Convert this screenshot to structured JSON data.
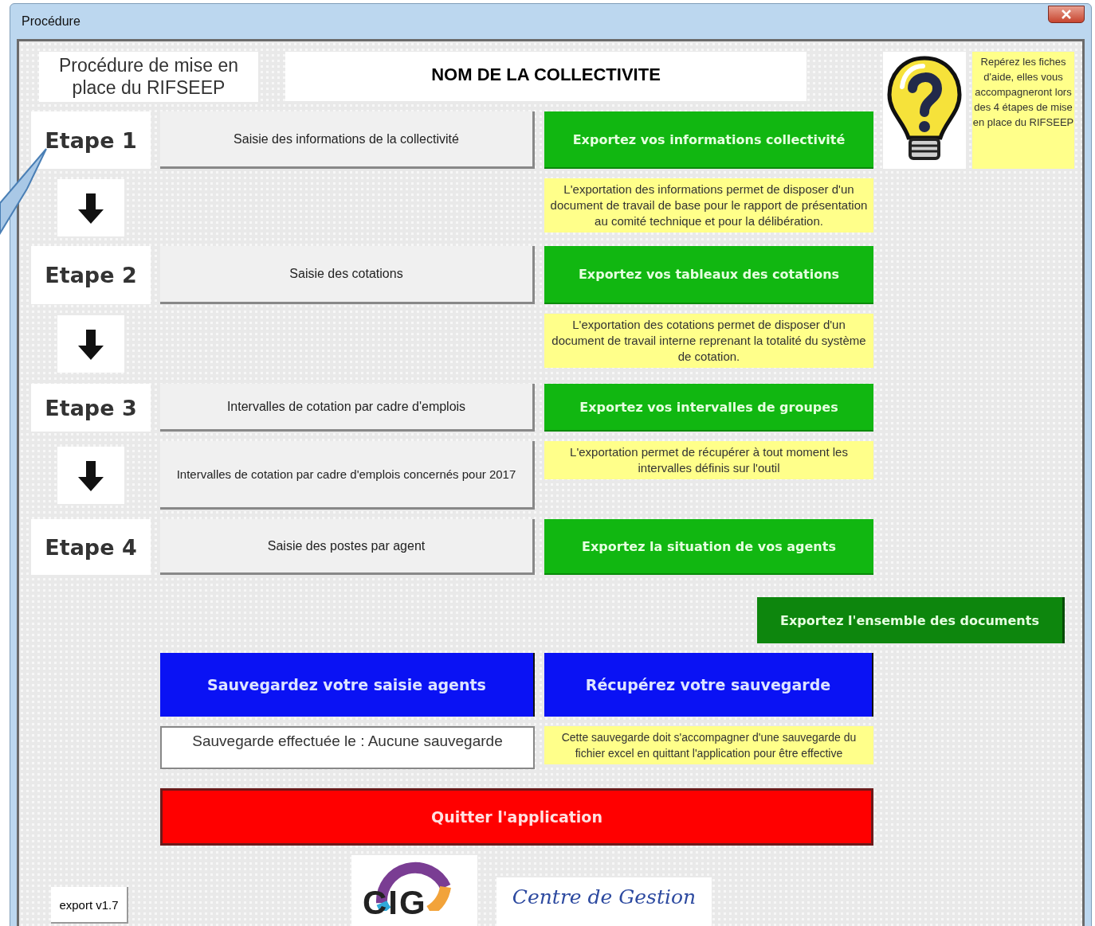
{
  "window": {
    "title": "Procédure"
  },
  "header": {
    "title": "Procédure de mise en place du RIFSEEP",
    "collectivity_name": "NOM DE LA COLLECTIVITE"
  },
  "help": {
    "text": "Repérez les fiches d'aide, elles vous accompagneront lors des 4 étapes de mise en place du RIFSEEP"
  },
  "rows": [
    {
      "kind": "step",
      "label": "Etape 1",
      "action": "Saisie des informations de la collectivité",
      "export": "Exportez vos informations collectivité"
    },
    {
      "kind": "link",
      "note": "L'exportation des informations permet de disposer d'un document de travail de base pour le rapport de présentation au comité technique et pour la délibération."
    },
    {
      "kind": "step",
      "label": "Etape 2",
      "action": "Saisie des cotations",
      "export": "Exportez vos tableaux des cotations"
    },
    {
      "kind": "link",
      "note": "L'exportation des cotations permet de disposer d'un document de travail interne reprenant la totalité du système de cotation."
    },
    {
      "kind": "step",
      "label": "Etape 3",
      "action": "Intervalles de cotation par cadre d'emplois",
      "export": "Exportez vos intervalles de groupes"
    },
    {
      "kind": "link",
      "action": "Intervalles de cotation par cadre d'emplois concernés pour 2017",
      "note": "L'exportation permet de récupérer à tout moment les intervalles définis sur l'outil"
    },
    {
      "kind": "step",
      "label": "Etape 4",
      "action": "Saisie des postes par agent",
      "export": "Exportez la situation de vos agents"
    }
  ],
  "export_all": "Exportez l'ensemble des documents",
  "save_button": "Sauvegardez votre saisie agents",
  "restore_button": "Récupérez votre sauvegarde",
  "save_status": "Sauvegarde effectuée le : Aucune sauvegarde",
  "save_note": "Cette sauvegarde doit s'accompagner d'une sauvegarde du fichier excel en quittant l'application pour être effective",
  "quit_button": "Quitter l'application",
  "footer": {
    "version": "export v1.7",
    "logo_text": "CIG",
    "signature": "Centre de Gestion"
  }
}
